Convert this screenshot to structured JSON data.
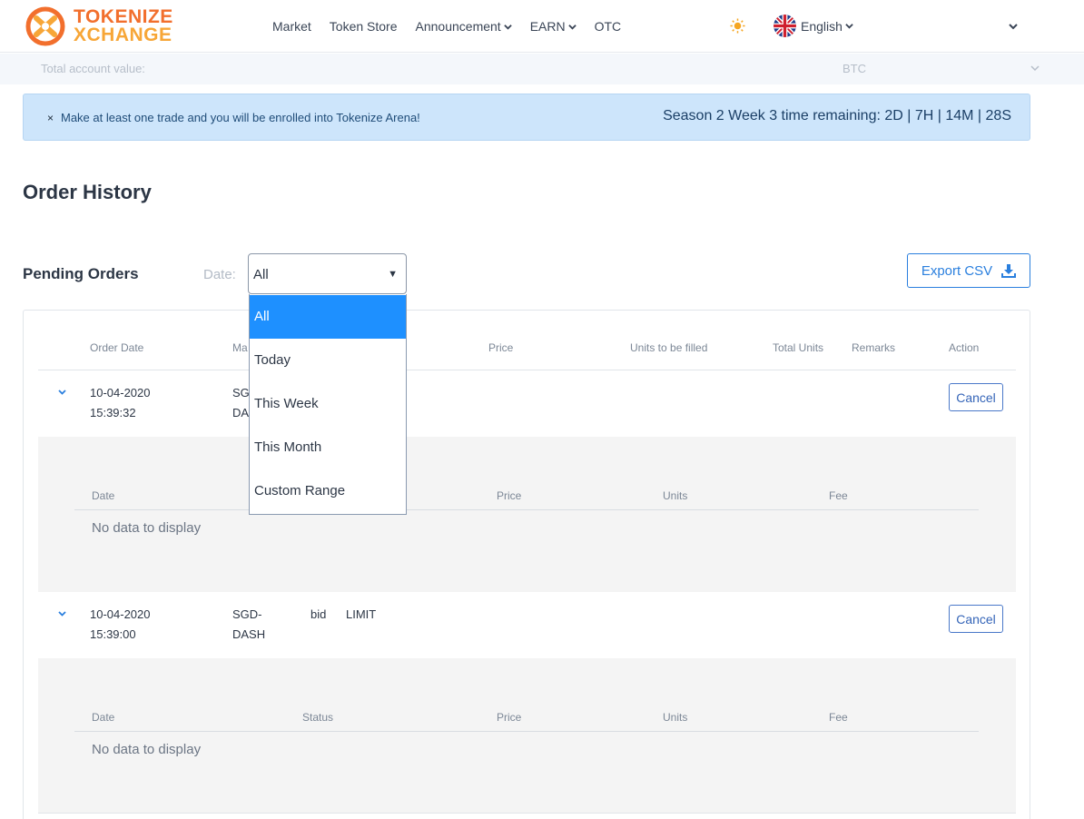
{
  "brand": {
    "line1": "TOKENIZE",
    "line2": "XCHANGE"
  },
  "nav": {
    "items": [
      {
        "label": "Market",
        "dropdown": false
      },
      {
        "label": "Token Store",
        "dropdown": false
      },
      {
        "label": "Announcement",
        "dropdown": true
      },
      {
        "label": "EARN",
        "dropdown": true
      },
      {
        "label": "OTC",
        "dropdown": false
      }
    ],
    "language": "English"
  },
  "account_bar": {
    "label": "Total account value:",
    "currency": "BTC"
  },
  "banner": {
    "close": "×",
    "message": "Make at least one trade and you will be enrolled into Tokenize Arena!",
    "timer": "Season 2 Week 3 time remaining: 2D | 7H | 14M | 28S"
  },
  "page_title": "Order History",
  "pending": {
    "title": "Pending Orders",
    "date_label": "Date:",
    "date_selected": "All",
    "date_options": [
      "All",
      "Today",
      "This Week",
      "This Month",
      "Custom Range"
    ],
    "export_label": "Export CSV"
  },
  "table": {
    "headers": {
      "order_date": "Order Date",
      "market": "Ma",
      "price": "Price",
      "units_to_fill": "Units to be filled",
      "total_units": "Total Units",
      "remarks": "Remarks",
      "action": "Action"
    },
    "rows": [
      {
        "date": "10-04-2020",
        "time": "15:39:32",
        "market_1": "SGD-",
        "market_2": "DASH",
        "side": "",
        "type": "",
        "action": "Cancel"
      },
      {
        "date": "10-04-2020",
        "time": "15:39:00",
        "market_1": "SGD-",
        "market_2": "DASH",
        "side": "bid",
        "type": "LIMIT",
        "action": "Cancel"
      }
    ],
    "sub_headers": {
      "date": "Date",
      "status": "Status",
      "price": "Price",
      "units": "Units",
      "fee": "Fee"
    },
    "no_data": "No data to display"
  },
  "colors": {
    "brand_orange": "#f26f2d",
    "brand_yellow": "#f7a637",
    "accent_blue": "#2a7fde",
    "banner_bg": "#cde5fb",
    "selected_option": "#1e90ff"
  }
}
